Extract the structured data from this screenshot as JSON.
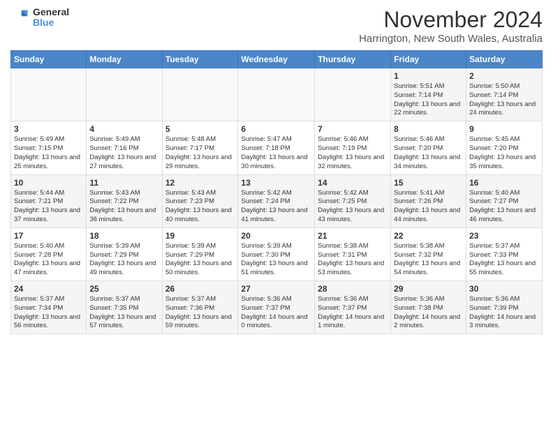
{
  "logo": {
    "general": "General",
    "blue": "Blue"
  },
  "header": {
    "month": "November 2024",
    "location": "Harrington, New South Wales, Australia"
  },
  "weekdays": [
    "Sunday",
    "Monday",
    "Tuesday",
    "Wednesday",
    "Thursday",
    "Friday",
    "Saturday"
  ],
  "weeks": [
    [
      {
        "day": "",
        "info": ""
      },
      {
        "day": "",
        "info": ""
      },
      {
        "day": "",
        "info": ""
      },
      {
        "day": "",
        "info": ""
      },
      {
        "day": "",
        "info": ""
      },
      {
        "day": "1",
        "info": "Sunrise: 5:51 AM\nSunset: 7:14 PM\nDaylight: 13 hours\nand 22 minutes."
      },
      {
        "day": "2",
        "info": "Sunrise: 5:50 AM\nSunset: 7:14 PM\nDaylight: 13 hours\nand 24 minutes."
      }
    ],
    [
      {
        "day": "3",
        "info": "Sunrise: 5:49 AM\nSunset: 7:15 PM\nDaylight: 13 hours\nand 25 minutes."
      },
      {
        "day": "4",
        "info": "Sunrise: 5:49 AM\nSunset: 7:16 PM\nDaylight: 13 hours\nand 27 minutes."
      },
      {
        "day": "5",
        "info": "Sunrise: 5:48 AM\nSunset: 7:17 PM\nDaylight: 13 hours\nand 29 minutes."
      },
      {
        "day": "6",
        "info": "Sunrise: 5:47 AM\nSunset: 7:18 PM\nDaylight: 13 hours\nand 30 minutes."
      },
      {
        "day": "7",
        "info": "Sunrise: 5:46 AM\nSunset: 7:19 PM\nDaylight: 13 hours\nand 32 minutes."
      },
      {
        "day": "8",
        "info": "Sunrise: 5:46 AM\nSunset: 7:20 PM\nDaylight: 13 hours\nand 34 minutes."
      },
      {
        "day": "9",
        "info": "Sunrise: 5:45 AM\nSunset: 7:20 PM\nDaylight: 13 hours\nand 35 minutes."
      }
    ],
    [
      {
        "day": "10",
        "info": "Sunrise: 5:44 AM\nSunset: 7:21 PM\nDaylight: 13 hours\nand 37 minutes."
      },
      {
        "day": "11",
        "info": "Sunrise: 5:43 AM\nSunset: 7:22 PM\nDaylight: 13 hours\nand 38 minutes."
      },
      {
        "day": "12",
        "info": "Sunrise: 5:43 AM\nSunset: 7:23 PM\nDaylight: 13 hours\nand 40 minutes."
      },
      {
        "day": "13",
        "info": "Sunrise: 5:42 AM\nSunset: 7:24 PM\nDaylight: 13 hours\nand 41 minutes."
      },
      {
        "day": "14",
        "info": "Sunrise: 5:42 AM\nSunset: 7:25 PM\nDaylight: 13 hours\nand 43 minutes."
      },
      {
        "day": "15",
        "info": "Sunrise: 5:41 AM\nSunset: 7:26 PM\nDaylight: 13 hours\nand 44 minutes."
      },
      {
        "day": "16",
        "info": "Sunrise: 5:40 AM\nSunset: 7:27 PM\nDaylight: 13 hours\nand 46 minutes."
      }
    ],
    [
      {
        "day": "17",
        "info": "Sunrise: 5:40 AM\nSunset: 7:28 PM\nDaylight: 13 hours\nand 47 minutes."
      },
      {
        "day": "18",
        "info": "Sunrise: 5:39 AM\nSunset: 7:29 PM\nDaylight: 13 hours\nand 49 minutes."
      },
      {
        "day": "19",
        "info": "Sunrise: 5:39 AM\nSunset: 7:29 PM\nDaylight: 13 hours\nand 50 minutes."
      },
      {
        "day": "20",
        "info": "Sunrise: 5:39 AM\nSunset: 7:30 PM\nDaylight: 13 hours\nand 51 minutes."
      },
      {
        "day": "21",
        "info": "Sunrise: 5:38 AM\nSunset: 7:31 PM\nDaylight: 13 hours\nand 53 minutes."
      },
      {
        "day": "22",
        "info": "Sunrise: 5:38 AM\nSunset: 7:32 PM\nDaylight: 13 hours\nand 54 minutes."
      },
      {
        "day": "23",
        "info": "Sunrise: 5:37 AM\nSunset: 7:33 PM\nDaylight: 13 hours\nand 55 minutes."
      }
    ],
    [
      {
        "day": "24",
        "info": "Sunrise: 5:37 AM\nSunset: 7:34 PM\nDaylight: 13 hours\nand 56 minutes."
      },
      {
        "day": "25",
        "info": "Sunrise: 5:37 AM\nSunset: 7:35 PM\nDaylight: 13 hours\nand 57 minutes."
      },
      {
        "day": "26",
        "info": "Sunrise: 5:37 AM\nSunset: 7:36 PM\nDaylight: 13 hours\nand 59 minutes."
      },
      {
        "day": "27",
        "info": "Sunrise: 5:36 AM\nSunset: 7:37 PM\nDaylight: 14 hours\nand 0 minutes."
      },
      {
        "day": "28",
        "info": "Sunrise: 5:36 AM\nSunset: 7:37 PM\nDaylight: 14 hours\nand 1 minute."
      },
      {
        "day": "29",
        "info": "Sunrise: 5:36 AM\nSunset: 7:38 PM\nDaylight: 14 hours\nand 2 minutes."
      },
      {
        "day": "30",
        "info": "Sunrise: 5:36 AM\nSunset: 7:39 PM\nDaylight: 14 hours\nand 3 minutes."
      }
    ]
  ]
}
